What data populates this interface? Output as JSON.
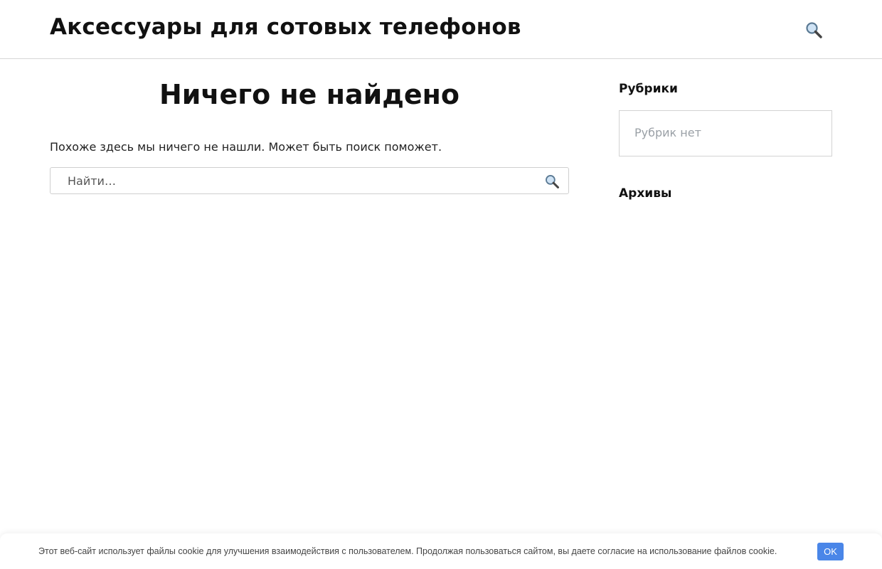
{
  "header": {
    "site_title": "Аксессуары для сотовых телефонов",
    "search_icon": "search-icon"
  },
  "main": {
    "title": "Ничего не найдено",
    "message": "Похоже здесь мы ничего не нашли. Может быть поиск поможет.",
    "search": {
      "placeholder": "Найти…",
      "value": "",
      "submit_icon": "search-icon"
    }
  },
  "sidebar": {
    "categories": {
      "title": "Рубрики",
      "empty_text": "Рубрик нет"
    },
    "archives": {
      "title": "Архивы"
    }
  },
  "cookie_bar": {
    "text": "Этот веб-сайт использует файлы cookie для улучшения взаимодействия с пользователем. Продолжая пользоваться сайтом, вы даете согласие на использование файлов cookie.",
    "ok_label": "OK"
  },
  "colors": {
    "accent": "#4a86e8",
    "border": "#d6d6d6",
    "muted_text": "#9aa0a6"
  }
}
